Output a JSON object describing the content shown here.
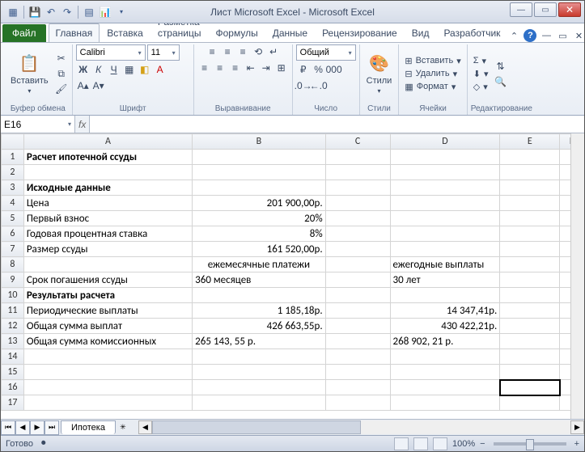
{
  "title": "Лист Microsoft Excel  -  Microsoft Excel",
  "tabs": {
    "file": "Файл",
    "home": "Главная",
    "insert": "Вставка",
    "pagelayout": "Разметка страницы",
    "formulas": "Формулы",
    "data": "Данные",
    "review": "Рецензирование",
    "view": "Вид",
    "developer": "Разработчик"
  },
  "ribbon": {
    "clipboard": {
      "label": "Буфер обмена",
      "paste": "Вставить"
    },
    "font": {
      "label": "Шрифт",
      "name": "Calibri",
      "size": "11",
      "bold": "Ж",
      "italic": "К",
      "underline": "Ч"
    },
    "alignment": {
      "label": "Выравнивание"
    },
    "number": {
      "label": "Число",
      "format": "Общий"
    },
    "styles": {
      "label": "Стили",
      "btn": "Стили"
    },
    "cells": {
      "label": "Ячейки",
      "insert": "Вставить",
      "delete": "Удалить",
      "format": "Формат"
    },
    "editing": {
      "label": "Редактирование"
    }
  },
  "namebox": "E16",
  "columns": [
    "A",
    "B",
    "C",
    "D",
    "E",
    "F"
  ],
  "rows": [
    {
      "n": "1",
      "A": "Расчет ипотечной ссуды",
      "bold": true
    },
    {
      "n": "2"
    },
    {
      "n": "3",
      "A": "Исходные данные",
      "bold": true
    },
    {
      "n": "4",
      "A": "Цена",
      "B": "201 900,00р."
    },
    {
      "n": "5",
      "A": "Первый взнос",
      "B": "20%"
    },
    {
      "n": "6",
      "A": "Годовая процентная ставка",
      "B": "8%"
    },
    {
      "n": "7",
      "A": "Размер ссуды",
      "B": "161 520,00р."
    },
    {
      "n": "8",
      "B": "ежемесячные платежи",
      "Bcenter": true,
      "D": "ежегодные выплаты"
    },
    {
      "n": "9",
      "A": "Срок погашения ссуды",
      "B": "360 месяцев",
      "Bleft": true,
      "D": "30 лет"
    },
    {
      "n": "10",
      "A": "Результаты расчета",
      "bold": true
    },
    {
      "n": "11",
      "A": "Периодические выплаты",
      "B": "1 185,18р.",
      "D": "14 347,41р.",
      "Dright": true
    },
    {
      "n": "12",
      "A": "Общая сумма выплат",
      "B": "426 663,55р.",
      "D": "430 422,21р.",
      "Dright": true
    },
    {
      "n": "13",
      "A": "Общая сумма комиссионных",
      "B": "265 143, 55 р.",
      "Bleft": true,
      "D": "268 902, 21 р."
    },
    {
      "n": "14"
    },
    {
      "n": "15"
    },
    {
      "n": "16",
      "sel": "E"
    },
    {
      "n": "17"
    }
  ],
  "sheet": "Ипотека",
  "status": {
    "ready": "Готово",
    "zoom": "100%"
  },
  "zoom": {
    "minus": "−",
    "plus": "+"
  },
  "chart_data": null
}
